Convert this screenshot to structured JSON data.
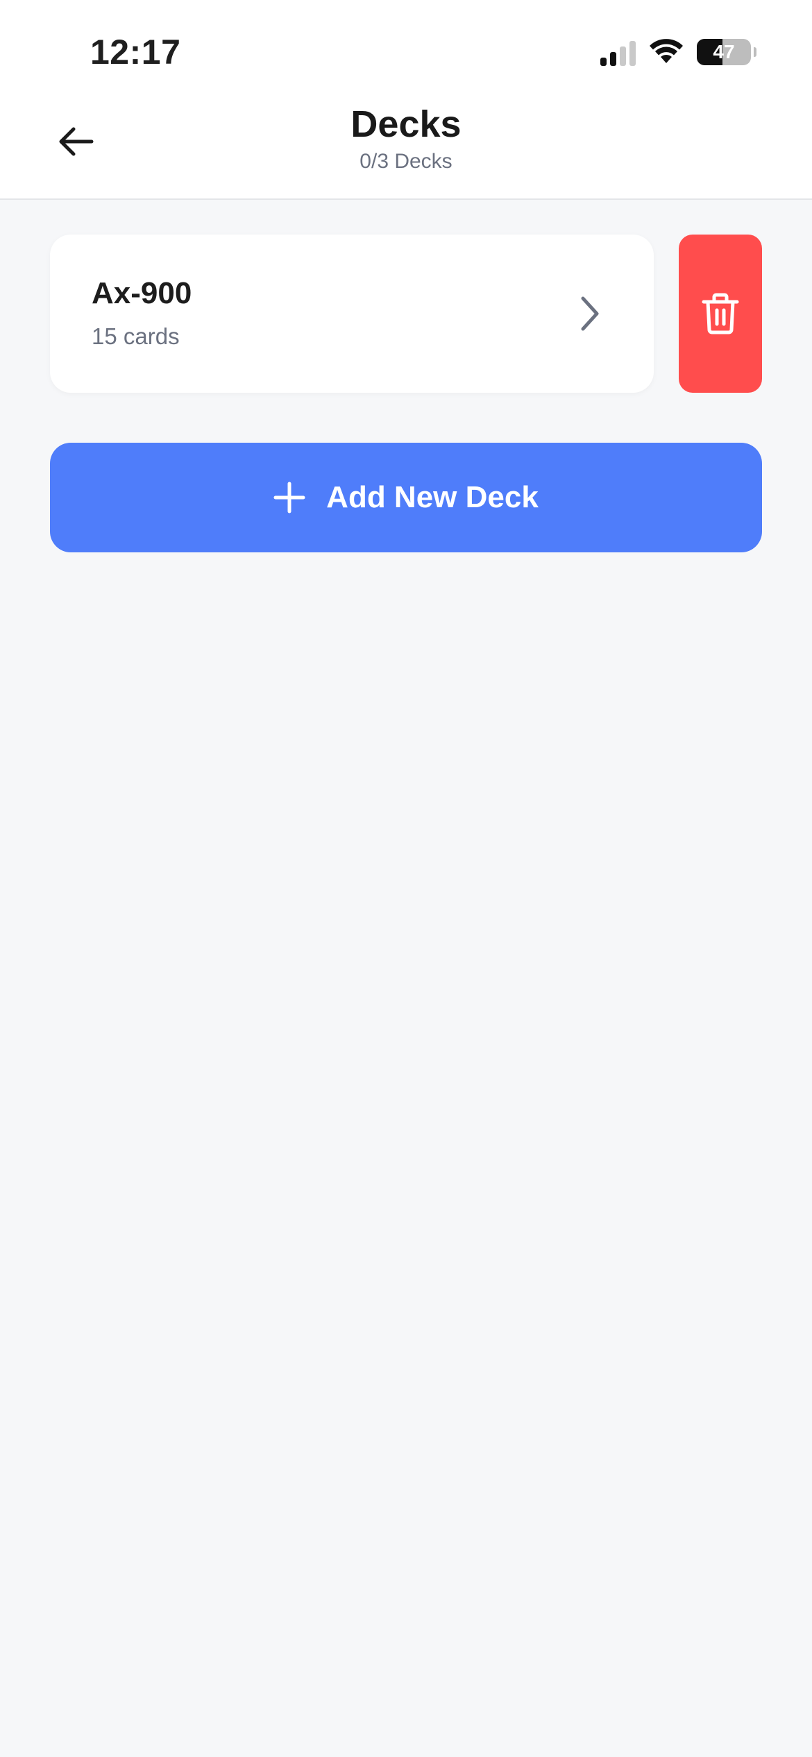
{
  "status_bar": {
    "time": "12:17",
    "battery_level": "47",
    "battery_fraction": 0.47
  },
  "header": {
    "title": "Decks",
    "subtitle": "0/3 Decks",
    "back_icon": "arrow-left-icon"
  },
  "decks": [
    {
      "name": "Ax-900",
      "count": "15 cards",
      "chevron_icon": "chevron-right-icon",
      "delete_icon": "trash-icon"
    }
  ],
  "add_button": {
    "label": "Add New Deck",
    "icon": "plus-icon"
  },
  "colors": {
    "primary": "#4f7dfa",
    "danger": "#ff4d4d",
    "background": "#f6f7f9",
    "muted_text": "#6b7180"
  }
}
